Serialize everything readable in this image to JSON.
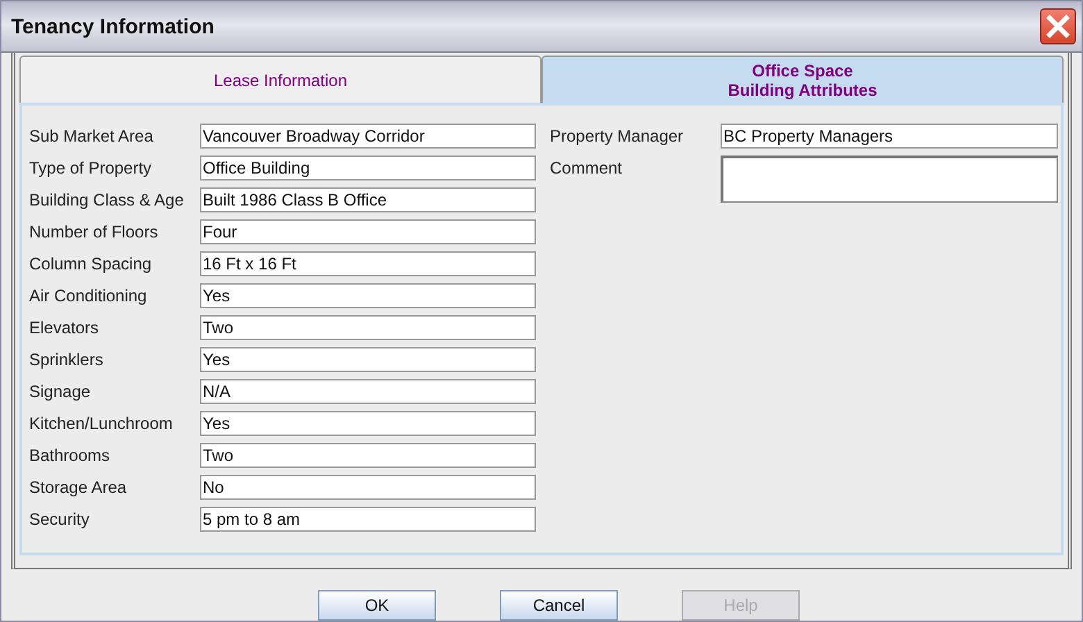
{
  "window": {
    "title": "Tenancy Information"
  },
  "tabs": [
    {
      "label": "Lease Information",
      "selected": false
    },
    {
      "label": "Office Space\nBuilding Attributes",
      "selected": true
    }
  ],
  "left_fields": [
    {
      "label": "Sub Market Area",
      "value": "Vancouver Broadway Corridor"
    },
    {
      "label": "Type of Property",
      "value": "Office Building"
    },
    {
      "label": "Building Class & Age",
      "value": "Built 1986 Class B Office"
    },
    {
      "label": "Number of Floors",
      "value": "Four"
    },
    {
      "label": "Column Spacing",
      "value": "16 Ft x 16 Ft"
    },
    {
      "label": "Air Conditioning",
      "value": "Yes"
    },
    {
      "label": "Elevators",
      "value": "Two"
    },
    {
      "label": "Sprinklers",
      "value": "Yes"
    },
    {
      "label": "Signage",
      "value": "N/A"
    },
    {
      "label": "Kitchen/Lunchroom",
      "value": "Yes"
    },
    {
      "label": "Bathrooms",
      "value": "Two"
    },
    {
      "label": "Storage Area",
      "value": "No"
    },
    {
      "label": "Security",
      "value": "5 pm to 8 am"
    }
  ],
  "right_fields": [
    {
      "label": "Property Manager",
      "value": "BC Property Managers",
      "kind": "line"
    },
    {
      "label": "Comment",
      "kind": "area"
    }
  ],
  "buttons": [
    {
      "label": "OK",
      "disabled": false
    },
    {
      "label": "Cancel",
      "disabled": false
    },
    {
      "label": "Help",
      "disabled": true
    }
  ]
}
